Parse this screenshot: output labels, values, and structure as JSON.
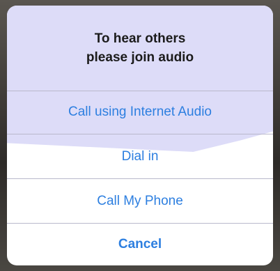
{
  "dialog": {
    "title_line_1": "To hear others",
    "title_line_2": "please join audio",
    "options": [
      {
        "label": "Call using Internet Audio"
      },
      {
        "label": "Dial in"
      },
      {
        "label": "Call My Phone"
      },
      {
        "label": "Cancel"
      }
    ]
  },
  "colors": {
    "action_blue": "#2d7fe0",
    "title_text": "#1b1b1b",
    "sheet_tint": "#dddcf8"
  }
}
